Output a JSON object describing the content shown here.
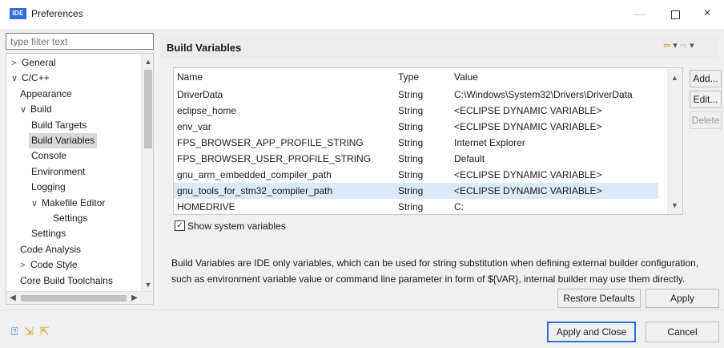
{
  "window": {
    "app_badge": "IDE",
    "title": "Preferences",
    "min_glyph": "—",
    "close_glyph": "×"
  },
  "filter": {
    "placeholder": "type filter text"
  },
  "tree": {
    "items": [
      {
        "label": "General",
        "twisty": ">",
        "level": 0
      },
      {
        "label": "C/C++",
        "twisty": "∨",
        "level": 0
      },
      {
        "label": "Appearance",
        "twisty": "",
        "level": 1
      },
      {
        "label": "Build",
        "twisty": "∨",
        "level": 1
      },
      {
        "label": "Build Targets",
        "twisty": "",
        "level": 2
      },
      {
        "label": "Build Variables",
        "twisty": "",
        "level": 2,
        "selected": true
      },
      {
        "label": "Console",
        "twisty": "",
        "level": 2
      },
      {
        "label": "Environment",
        "twisty": "",
        "level": 2
      },
      {
        "label": "Logging",
        "twisty": "",
        "level": 2
      },
      {
        "label": "Makefile Editor",
        "twisty": "∨",
        "level": 2
      },
      {
        "label": "Settings",
        "twisty": "",
        "level": 3
      },
      {
        "label": "Settings",
        "twisty": "",
        "level": 2
      },
      {
        "label": "Code Analysis",
        "twisty": "",
        "level": 1
      },
      {
        "label": "Code Style",
        "twisty": ">",
        "level": 1
      },
      {
        "label": "Core Build Toolchains",
        "twisty": "",
        "level": 1
      }
    ]
  },
  "page": {
    "title": "Build Variables",
    "nav": {
      "back": "⇦",
      "dropdown": "▾",
      "forward": "⇨",
      "menu": "▾"
    }
  },
  "table": {
    "columns": [
      "Name",
      "Type",
      "Value"
    ],
    "rows": [
      {
        "name": "DriverData",
        "type": "String",
        "value": "C:\\Windows\\System32\\Drivers\\DriverData"
      },
      {
        "name": "eclipse_home",
        "type": "String",
        "value": "<ECLIPSE DYNAMIC VARIABLE>"
      },
      {
        "name": "env_var",
        "type": "String",
        "value": "<ECLIPSE DYNAMIC VARIABLE>"
      },
      {
        "name": "FPS_BROWSER_APP_PROFILE_STRING",
        "type": "String",
        "value": "Internet Explorer"
      },
      {
        "name": "FPS_BROWSER_USER_PROFILE_STRING",
        "type": "String",
        "value": "Default"
      },
      {
        "name": "gnu_arm_embedded_compiler_path",
        "type": "String",
        "value": "<ECLIPSE DYNAMIC VARIABLE>"
      },
      {
        "name": "gnu_tools_for_stm32_compiler_path",
        "type": "String",
        "value": "<ECLIPSE DYNAMIC VARIABLE>",
        "selected": true
      },
      {
        "name": "HOMEDRIVE",
        "type": "String",
        "value": "C:"
      }
    ]
  },
  "buttons": {
    "add": "Add...",
    "edit": "Edit...",
    "delete": "Delete",
    "restore_defaults": "Restore Defaults",
    "apply": "Apply",
    "apply_and_close": "Apply and Close",
    "cancel": "Cancel"
  },
  "show_system_variables": {
    "label": "Show system variables",
    "checked": true
  },
  "description": "Build Variables are IDE only variables, which can be used for string substitution when defining external builder configuration, such as environment variable value or command line parameter in form of ${VAR}, internal builder may use them directly.",
  "footer_icons": [
    "help-icon",
    "import-icon",
    "export-icon"
  ],
  "colors": {
    "accent": "#2f6fd6",
    "selection": "#dbe9f8",
    "tree_selection": "#d9d9d9"
  }
}
